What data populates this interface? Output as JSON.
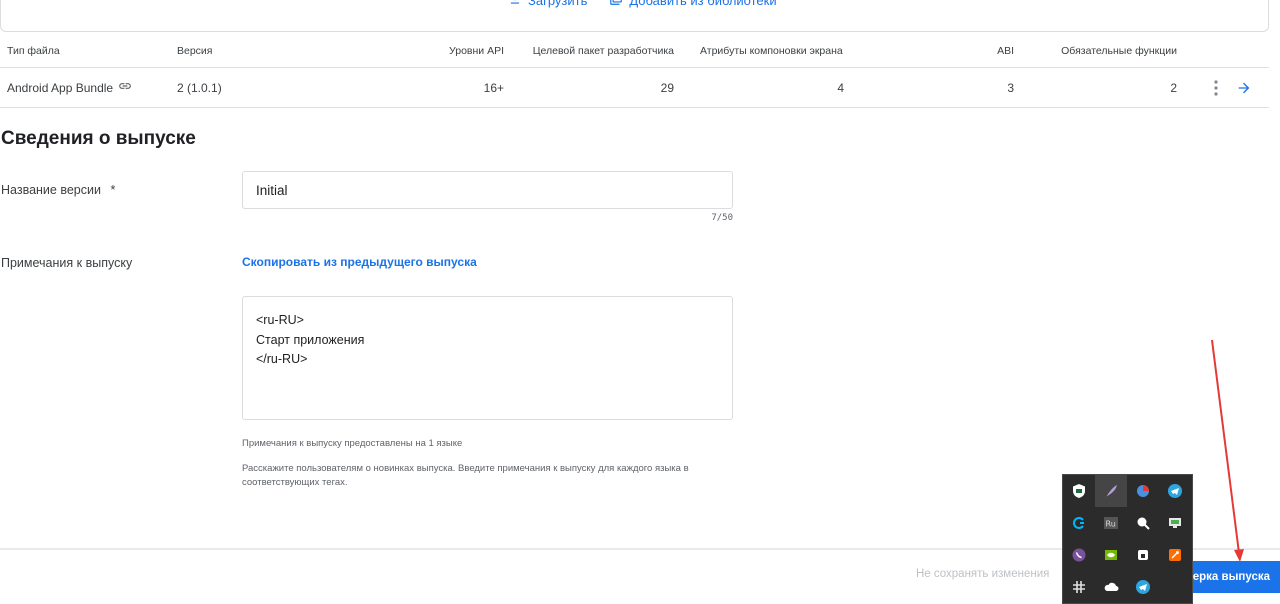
{
  "upload": {
    "upload_label": "Загрузить",
    "library_label": "Добавить из библиотеки"
  },
  "table": {
    "headers": {
      "file_type": "Тип файла",
      "version": "Версия",
      "api_levels": "Уровни API",
      "target_sdk": "Целевой пакет разработчика",
      "screen_layouts": "Атрибуты компоновки экрана",
      "abi": "ABI",
      "required_features": "Обязательные функции"
    },
    "rows": [
      {
        "file_type": "Android App Bundle",
        "version": "2 (1.0.1)",
        "api_levels": "16+",
        "target_sdk": "29",
        "screen_layouts": "4",
        "abi": "3",
        "required_features": "2"
      }
    ]
  },
  "release_details": {
    "title": "Сведения о выпуске",
    "version_name_label": "Название версии",
    "required_mark": "*",
    "version_name_value": "Initial",
    "version_name_counter": "7/50",
    "notes_label": "Примечания к выпуску",
    "copy_link": "Скопировать из предыдущего выпуска",
    "notes_lines": [
      "<ru-RU>",
      "Старт приложения",
      "</ru-RU>"
    ],
    "hint_languages": "Примечания к выпуску предоставлены на 1 языке",
    "hint_instructions": "Расскажите пользователям о новинках выпуска. Введите примечания к выпуску для каждого языка в соответствующих тегах."
  },
  "footer": {
    "discard_label": "Не сохранять изменения",
    "review_button_label": "верка выпуска"
  },
  "tray": {
    "icons": [
      "kaspersky-icon",
      "feather-icon",
      "yandex-disk-icon",
      "telegram-icon",
      "logitech-icon",
      "ru-icon",
      "pointer-icon",
      "remote-desktop-icon",
      "viber-icon",
      "nvidia-icon",
      "keeper-icon",
      "tool-icon",
      "slack-icon",
      "onedrive-icon",
      "telegram-icon"
    ]
  },
  "colors": {
    "accent": "#1a73e8",
    "annotation_arrow": "#e53935",
    "tray_bg": "#2b2b2b"
  }
}
